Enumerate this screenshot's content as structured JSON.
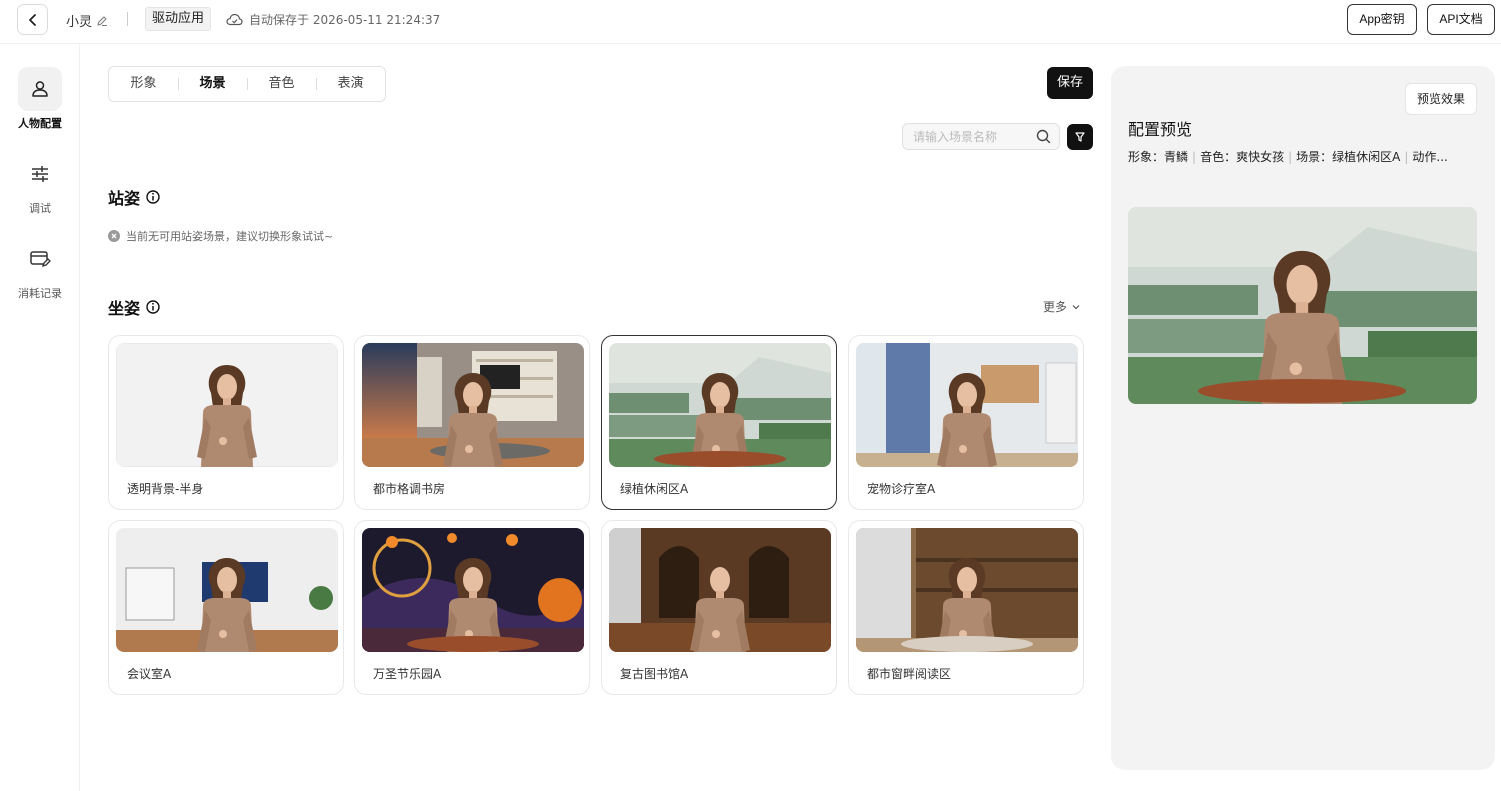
{
  "header": {
    "app_name": "小灵",
    "mode_tag": "驱动应用",
    "autosave": "自动保存于 2026-05-11 21:24:37",
    "app_key_btn": "App密钥",
    "api_doc_btn": "API文档"
  },
  "sidebar": {
    "items": [
      {
        "label": "人物配置",
        "icon": "person-icon"
      },
      {
        "label": "调试",
        "icon": "sliders-icon"
      },
      {
        "label": "消耗记录",
        "icon": "card-edit-icon"
      }
    ]
  },
  "tabs": [
    {
      "label": "形象"
    },
    {
      "label": "场景"
    },
    {
      "label": "音色"
    },
    {
      "label": "表演"
    }
  ],
  "active_tab": "场景",
  "save_label": "保存",
  "search": {
    "placeholder": "请输入场景名称"
  },
  "standing": {
    "title": "站姿",
    "empty_note": "当前无可用站姿场景，建议切换形象试试~"
  },
  "sitting": {
    "title": "坐姿",
    "more": "更多",
    "scenes": [
      {
        "label": "透明背景-半身"
      },
      {
        "label": "都市格调书房"
      },
      {
        "label": "绿植休闲区A"
      },
      {
        "label": "宠物诊疗室A"
      },
      {
        "label": "会议室A"
      },
      {
        "label": "万圣节乐园A"
      },
      {
        "label": "复古图书馆A"
      },
      {
        "label": "都市窗畔阅读区"
      }
    ]
  },
  "preview": {
    "button": "预览效果",
    "title": "配置预览",
    "meta_image": "形象：青鳞",
    "meta_voice": "音色：爽快女孩",
    "meta_scene": "场景：绿植休闲区A",
    "meta_action": "动作..."
  },
  "colors": {
    "accent": "#111111",
    "panel_bg": "#f3f3f3"
  }
}
